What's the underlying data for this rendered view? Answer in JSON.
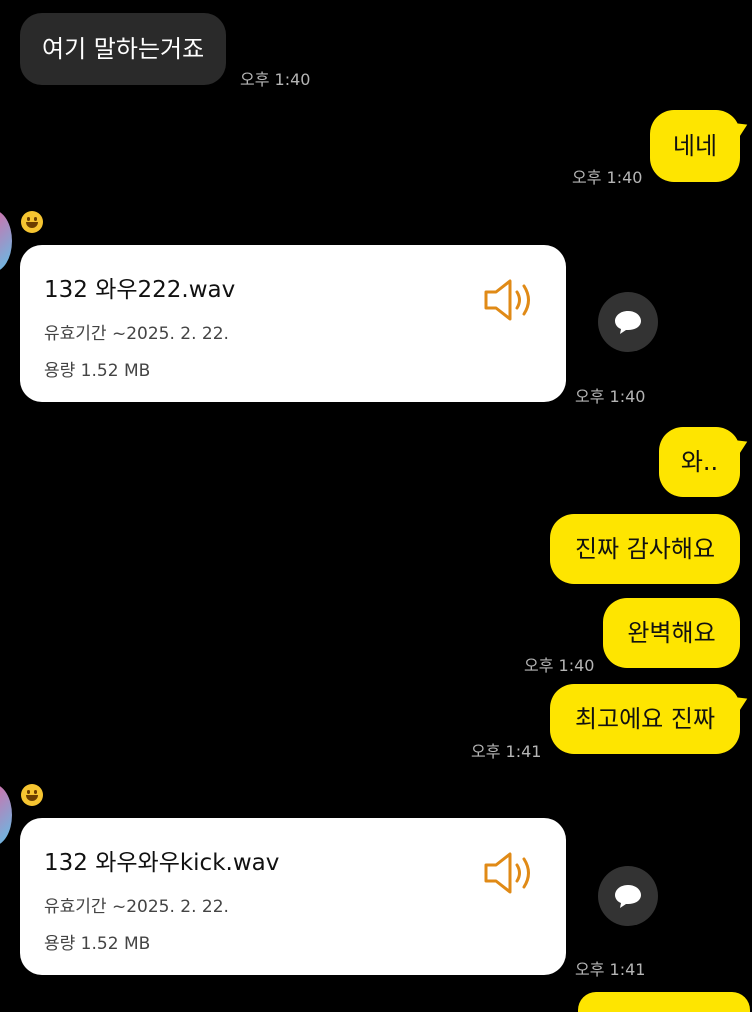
{
  "messages": {
    "m1": {
      "text": "여기 말하는거죠",
      "time": "오후 1:40"
    },
    "m2": {
      "text": "네네",
      "time": "오후 1:40"
    },
    "file1": {
      "name": "132 와우222.wav",
      "expiry": "유효기간 ~2025. 2. 22.",
      "size": "용량  1.52 MB",
      "time": "오후 1:40"
    },
    "m3": {
      "text": "와.."
    },
    "m4": {
      "text": "진짜 감사해요"
    },
    "m5": {
      "text": "완벽해요",
      "time": "오후 1:40"
    },
    "m6": {
      "text": "최고에요 진짜",
      "time": "오후 1:41"
    },
    "file2": {
      "name": "132 와우와우kick.wav",
      "expiry": "유효기간 ~2025. 2. 22.",
      "size": "용량  1.52 MB",
      "time": "오후 1:41"
    }
  },
  "icons": {
    "speaker": "speaker-icon",
    "share": "chat-share-icon",
    "emoji": "grinning-face-icon"
  },
  "colors": {
    "background": "#000000",
    "incoming_bubble": "#2a2a2a",
    "outgoing_bubble": "#fee500",
    "file_card": "#ffffff",
    "speaker_accent": "#e08a16",
    "timestamp": "#b5b5b5"
  }
}
